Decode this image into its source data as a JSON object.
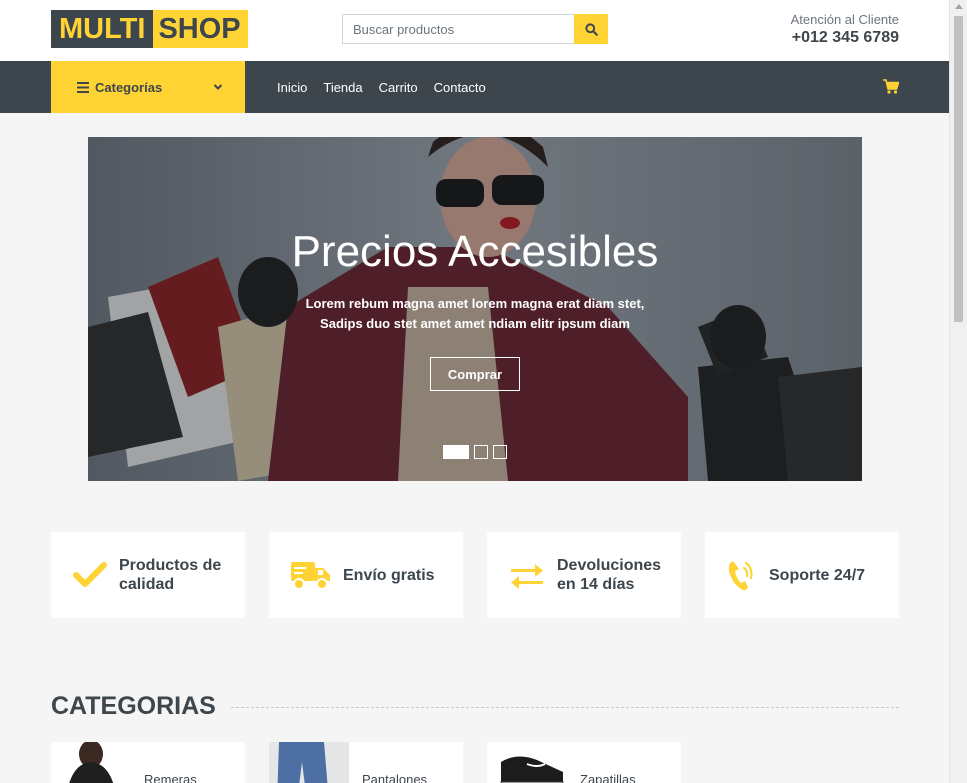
{
  "header": {
    "logo_part1": "MULTI",
    "logo_part2": "SHOP",
    "search_placeholder": "Buscar productos",
    "support_label": "Atención al Cliente",
    "support_phone": "+012 345 6789"
  },
  "navbar": {
    "categories_label": "Categorías",
    "links": [
      "Inicio",
      "Tienda",
      "Carrito",
      "Contacto"
    ]
  },
  "hero": {
    "title": "Precios Accesibles",
    "text": "Lorem rebum magna amet lorem magna erat diam stet, Sadips duo stet amet amet ndiam elitr ipsum diam",
    "button": "Comprar",
    "slides": 3,
    "active_slide": 1
  },
  "features": [
    {
      "icon": "check-icon",
      "label": "Productos de calidad"
    },
    {
      "icon": "truck-icon",
      "label": "Envío gratis"
    },
    {
      "icon": "exchange-icon",
      "label": "Devoluciones en 14 días"
    },
    {
      "icon": "phone-volume-icon",
      "label": "Soporte 24/7"
    }
  ],
  "categories": {
    "title": "CATEGORIAS",
    "items": [
      "Remeras",
      "Pantalones",
      "Zapatillas"
    ]
  },
  "colors": {
    "accent": "#FFD333",
    "dark": "#3D464D",
    "background": "#F5F5F5"
  }
}
